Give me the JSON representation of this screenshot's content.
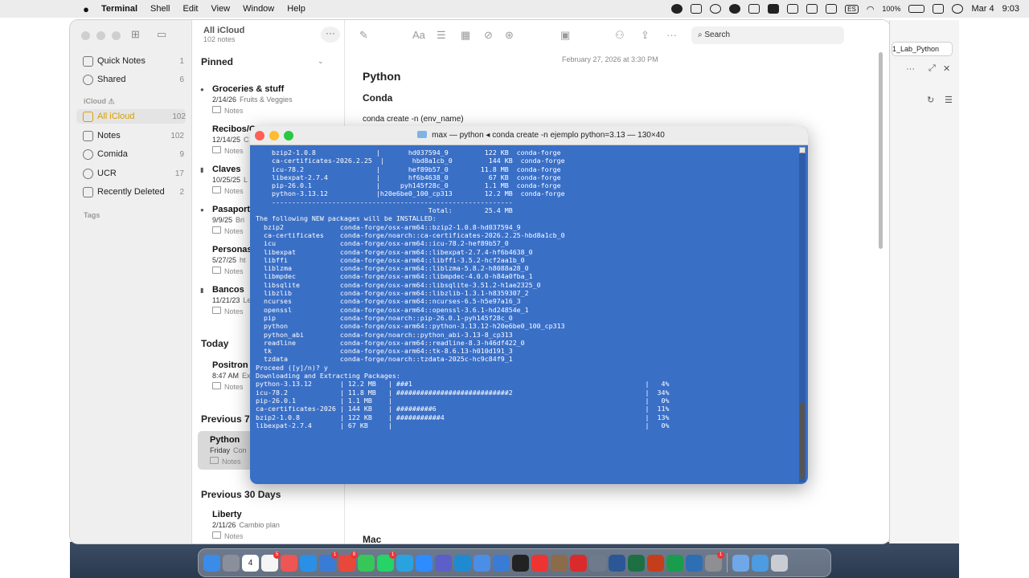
{
  "menubar": {
    "app": "Terminal",
    "menus": [
      "Shell",
      "Edit",
      "View",
      "Window",
      "Help"
    ],
    "battery": "100%",
    "input_source": "ES",
    "date": "Mar 4",
    "time": "9:03"
  },
  "sidebar": {
    "folders": [
      {
        "label": "Quick Notes",
        "count": "1"
      },
      {
        "label": "Shared",
        "count": "6"
      }
    ],
    "icloud_header": "iCloud",
    "icloud": [
      {
        "label": "All iCloud",
        "count": "102"
      },
      {
        "label": "Notes",
        "count": "102"
      },
      {
        "label": "Comida",
        "count": "9"
      },
      {
        "label": "UCR",
        "count": "17"
      },
      {
        "label": "Recently Deleted",
        "count": "2"
      }
    ],
    "tags_header": "Tags"
  },
  "notelist": {
    "title": "All iCloud",
    "subtitle": "102 notes",
    "groups": {
      "pinned": "Pinned",
      "today": "Today",
      "prev7": "Previous 7 D",
      "prev30": "Previous 30 Days"
    },
    "notes": [
      {
        "title": "Groceries & stuff",
        "date": "2/14/26",
        "preview": "Fruits & Veggies",
        "folder": "Notes"
      },
      {
        "title": "Recibos/C",
        "date": "12/14/25",
        "preview": "C",
        "folder": "Notes"
      },
      {
        "title": "Claves",
        "date": "10/25/25",
        "preview": "L",
        "folder": "Notes"
      },
      {
        "title": "Pasaporte",
        "date": "9/9/25",
        "preview": "Bri",
        "folder": "Notes"
      },
      {
        "title": "Personas",
        "date": "5/27/25",
        "preview": "ht",
        "folder": "Notes"
      },
      {
        "title": "Bancos",
        "date": "11/21/23",
        "preview": "Le",
        "folder": "Notes"
      },
      {
        "title": "Positron /",
        "date": "8:47 AM",
        "preview": "Ex",
        "folder": "Notes"
      },
      {
        "title": "Python",
        "date": "Friday",
        "preview": "Con",
        "folder": "Notes"
      },
      {
        "title": "Liberty",
        "date": "2/11/26",
        "preview": "Cambio plan",
        "folder": "Notes"
      }
    ]
  },
  "editor": {
    "search_placeholder": "Search",
    "date": "February 27, 2026 at 3:30 PM",
    "title": "Python",
    "subtitle": "Conda",
    "line1": "conda create -n (env_name)",
    "bottom_heading": "Mac"
  },
  "rightpanel": {
    "tab": "1_Lab_Python"
  },
  "terminal": {
    "title": "max — python ◂ conda create -n ejemplo python=3.13 — 130×40",
    "lines": [
      "    bzip2-1.0.8               |       hd037594_9         122 KB  conda-forge",
      "    ca-certificates-2026.2.25  |       hbd8a1cb_0         144 KB  conda-forge",
      "    icu-78.2                  |       hef89b57_0        11.8 MB  conda-forge",
      "    libexpat-2.7.4            |       hf6b4638_0          67 KB  conda-forge",
      "    pip-26.0.1                |     pyh145f28c_0         1.1 MB  conda-forge",
      "    python-3.13.12            |h20e6be0_100_cp313        12.2 MB  conda-forge",
      "    ------------------------------------------------------------",
      "                                           Total:        25.4 MB",
      "",
      "The following NEW packages will be INSTALLED:",
      "",
      "  bzip2              conda-forge/osx-arm64::bzip2-1.0.8-hd037594_9",
      "  ca-certificates    conda-forge/noarch::ca-certificates-2026.2.25-hbd8a1cb_0",
      "  icu                conda-forge/osx-arm64::icu-78.2-hef89b57_0",
      "  libexpat           conda-forge/osx-arm64::libexpat-2.7.4-hf6b4638_0",
      "  libffi             conda-forge/osx-arm64::libffi-3.5.2-hcf2aa1b_0",
      "  liblzma            conda-forge/osx-arm64::liblzma-5.8.2-h8088a28_0",
      "  libmpdec           conda-forge/osx-arm64::libmpdec-4.0.0-h84a0fba_1",
      "  libsqlite          conda-forge/osx-arm64::libsqlite-3.51.2-h1ae2325_0",
      "  libzlib            conda-forge/osx-arm64::libzlib-1.3.1-h8359307_2",
      "  ncurses            conda-forge/osx-arm64::ncurses-6.5-h5e97a16_3",
      "  openssl            conda-forge/osx-arm64::openssl-3.6.1-hd24854e_1",
      "  pip                conda-forge/noarch::pip-26.0.1-pyh145f28c_0",
      "  python             conda-forge/osx-arm64::python-3.13.12-h20e6be0_100_cp313",
      "  python_abi         conda-forge/noarch::python_abi-3.13-8_cp313",
      "  readline           conda-forge/osx-arm64::readline-8.3-h46df422_0",
      "  tk                 conda-forge/osx-arm64::tk-8.6.13-h010d191_3",
      "  tzdata             conda-forge/noarch::tzdata-2025c-hc9c84f9_1",
      "",
      "",
      "Proceed ([y]/n)? y",
      "",
      "",
      "Downloading and Extracting Packages:",
      "python-3.13.12       | 12.2 MB   | ###1                                                          |   4%",
      "icu-78.2             | 11.8 MB   | ############################2                                 |  34%",
      "pip-26.0.1           | 1.1 MB    |                                                               |   0%",
      "ca-certificates-2026 | 144 KB    | #########6                                                    |  11%",
      "bzip2-1.0.8          | 122 KB    | ###########4                                                  |  13%",
      "libexpat-2.7.4       | 67 KB     |                                                               |   0%"
    ]
  },
  "dock": {
    "badges": [
      "5",
      "1",
      "8",
      "1",
      "1"
    ],
    "calendar_day": "4"
  }
}
